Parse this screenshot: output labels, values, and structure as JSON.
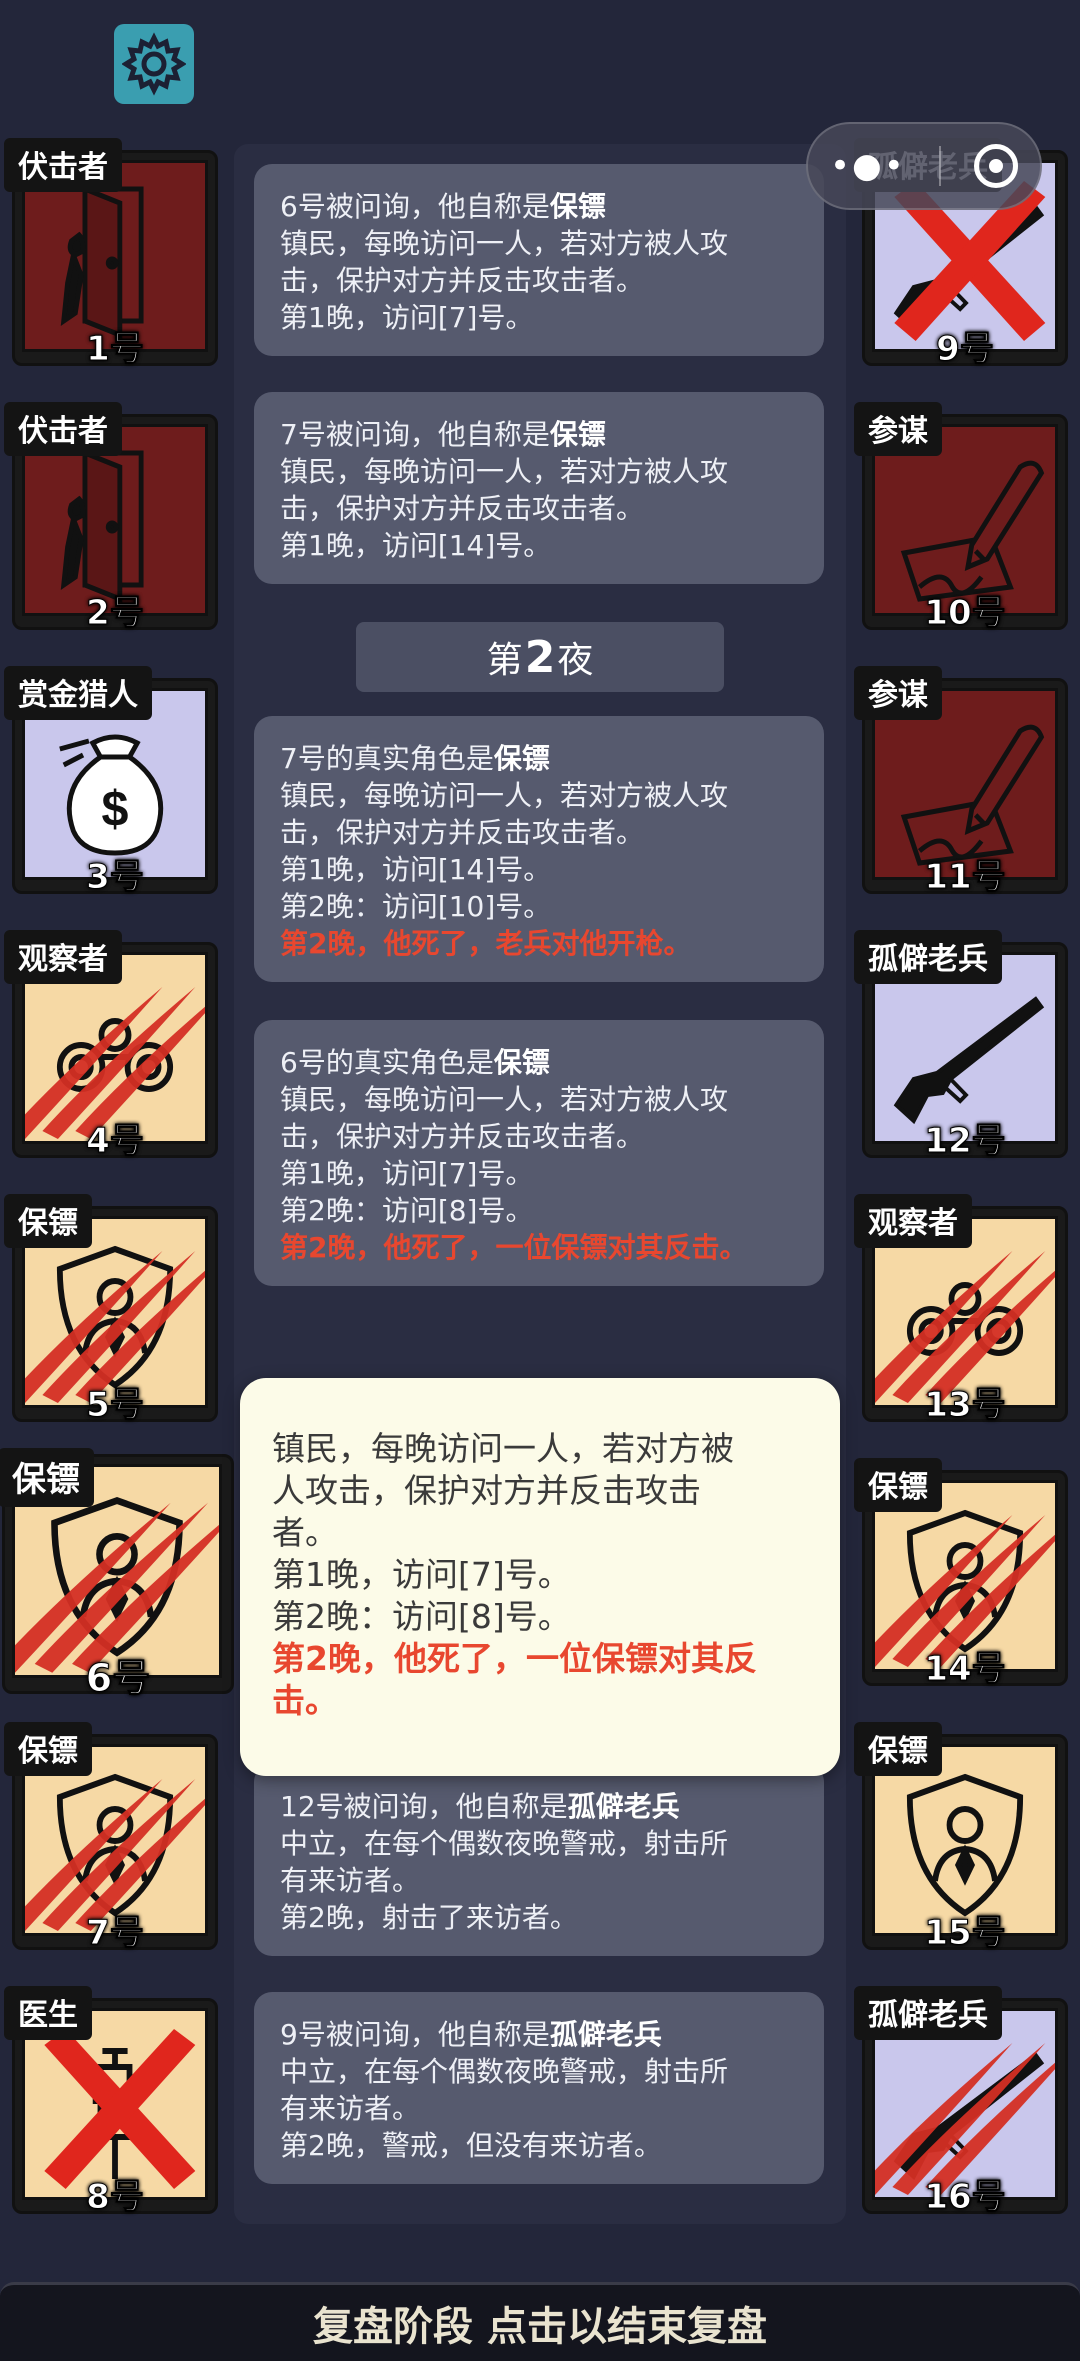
{
  "colors": {
    "dark_red": "#6e1c1c",
    "lavender": "#c9c7ec",
    "tan": "#f6d9a5",
    "dead": "#e8472f",
    "popup_bg": "#fcfbe8",
    "settings": "#3a9eb0"
  },
  "toolbar": {
    "settings_icon": "gear-icon",
    "capsule_more_icon": "more-dots-icon",
    "capsule_close_icon": "target-icon"
  },
  "left_players": [
    {
      "role": "伏击者",
      "num": "1号",
      "bg": "dark_red",
      "icon": "door-knife-icon",
      "mark": "none"
    },
    {
      "role": "伏击者",
      "num": "2号",
      "bg": "dark_red",
      "icon": "door-knife-icon",
      "mark": "none"
    },
    {
      "role": "赏金猎人",
      "num": "3号",
      "bg": "lavender",
      "icon": "money-bag-icon",
      "mark": "none"
    },
    {
      "role": "观察者",
      "num": "4号",
      "bg": "tan",
      "icon": "binoculars-icon",
      "mark": "claw"
    },
    {
      "role": "保镖",
      "num": "5号",
      "bg": "tan",
      "icon": "shield-person-icon",
      "mark": "claw"
    },
    {
      "role": "保镖",
      "num": "6号",
      "bg": "tan",
      "icon": "shield-person-icon",
      "mark": "claw"
    },
    {
      "role": "保镖",
      "num": "7号",
      "bg": "tan",
      "icon": "shield-person-icon",
      "mark": "claw"
    },
    {
      "role": "医生",
      "num": "8号",
      "bg": "tan",
      "icon": "syringe-icon",
      "mark": "cross"
    }
  ],
  "right_players": [
    {
      "role": "孤僻老兵",
      "num": "9号",
      "bg": "lavender",
      "icon": "rifle-icon",
      "mark": "cross"
    },
    {
      "role": "参谋",
      "num": "10号",
      "bg": "dark_red",
      "icon": "pen-paper-icon",
      "mark": "none"
    },
    {
      "role": "参谋",
      "num": "11号",
      "bg": "dark_red",
      "icon": "pen-paper-icon",
      "mark": "none"
    },
    {
      "role": "孤僻老兵",
      "num": "12号",
      "bg": "lavender",
      "icon": "rifle-icon",
      "mark": "none"
    },
    {
      "role": "观察者",
      "num": "13号",
      "bg": "tan",
      "icon": "binoculars-icon",
      "mark": "claw"
    },
    {
      "role": "保镖",
      "num": "14号",
      "bg": "tan",
      "icon": "shield-person-icon",
      "mark": "claw"
    },
    {
      "role": "保镖",
      "num": "15号",
      "bg": "tan",
      "icon": "shield-person-icon",
      "mark": "none"
    },
    {
      "role": "孤僻老兵",
      "num": "16号",
      "bg": "lavender",
      "icon": "rifle-icon",
      "mark": "claw"
    }
  ],
  "messages": [
    {
      "head": "6号被问询，他自称是",
      "head_role": "保镖",
      "lines": [
        "镇民，每晚访问一人，若对方被人攻",
        "击，保护对方并反击攻击者。",
        "第1晚，访问[7]号。"
      ],
      "dead": ""
    },
    {
      "head": "7号被问询，他自称是",
      "head_role": "保镖",
      "lines": [
        "镇民，每晚访问一人，若对方被人攻",
        "击，保护对方并反击攻击者。",
        "第1晚，访问[14]号。"
      ],
      "dead": ""
    },
    {
      "head": "7号的真实角色是",
      "head_role": "保镖",
      "lines": [
        "镇民，每晚访问一人，若对方被人攻",
        "击，保护对方并反击攻击者。",
        "第1晚，访问[14]号。",
        "第2晚：访问[10]号。"
      ],
      "dead": "第2晚，他死了，老兵对他开枪。"
    },
    {
      "head": "6号的真实角色是",
      "head_role": "保镖",
      "lines": [
        "镇民，每晚访问一人，若对方被人攻",
        "击，保护对方并反击攻击者。",
        "第1晚，访问[7]号。",
        "第2晚：访问[8]号。"
      ],
      "dead": "第2晚，他死了，一位保镖对其反击。"
    },
    {
      "head": "12号被问询，他自称是",
      "head_role": "孤僻老兵",
      "lines": [
        "中立，在每个偶数夜晚警戒，射击所",
        "有来访者。",
        "第2晚，射击了来访者。"
      ],
      "dead": ""
    },
    {
      "head": "9号被问询，他自称是",
      "head_role": "孤僻老兵",
      "lines": [
        "中立，在每个偶数夜晚警戒，射击所",
        "有来访者。",
        "第2晚，警戒，但没有来访者。"
      ],
      "dead": ""
    }
  ],
  "night_label": {
    "prefix": "第",
    "num": "2",
    "suffix": "夜"
  },
  "popup": {
    "lines": [
      "镇民，每晚访问一人，若对方被",
      "人攻击，保护对方并反击攻击",
      "者。",
      "第1晚，访问[7]号。",
      "第2晚：访问[8]号。"
    ],
    "dead": "第2晚，他死了，一位保镖对其反击。"
  },
  "bottom_bar": {
    "label": "复盘阶段 点击以结束复盘"
  }
}
